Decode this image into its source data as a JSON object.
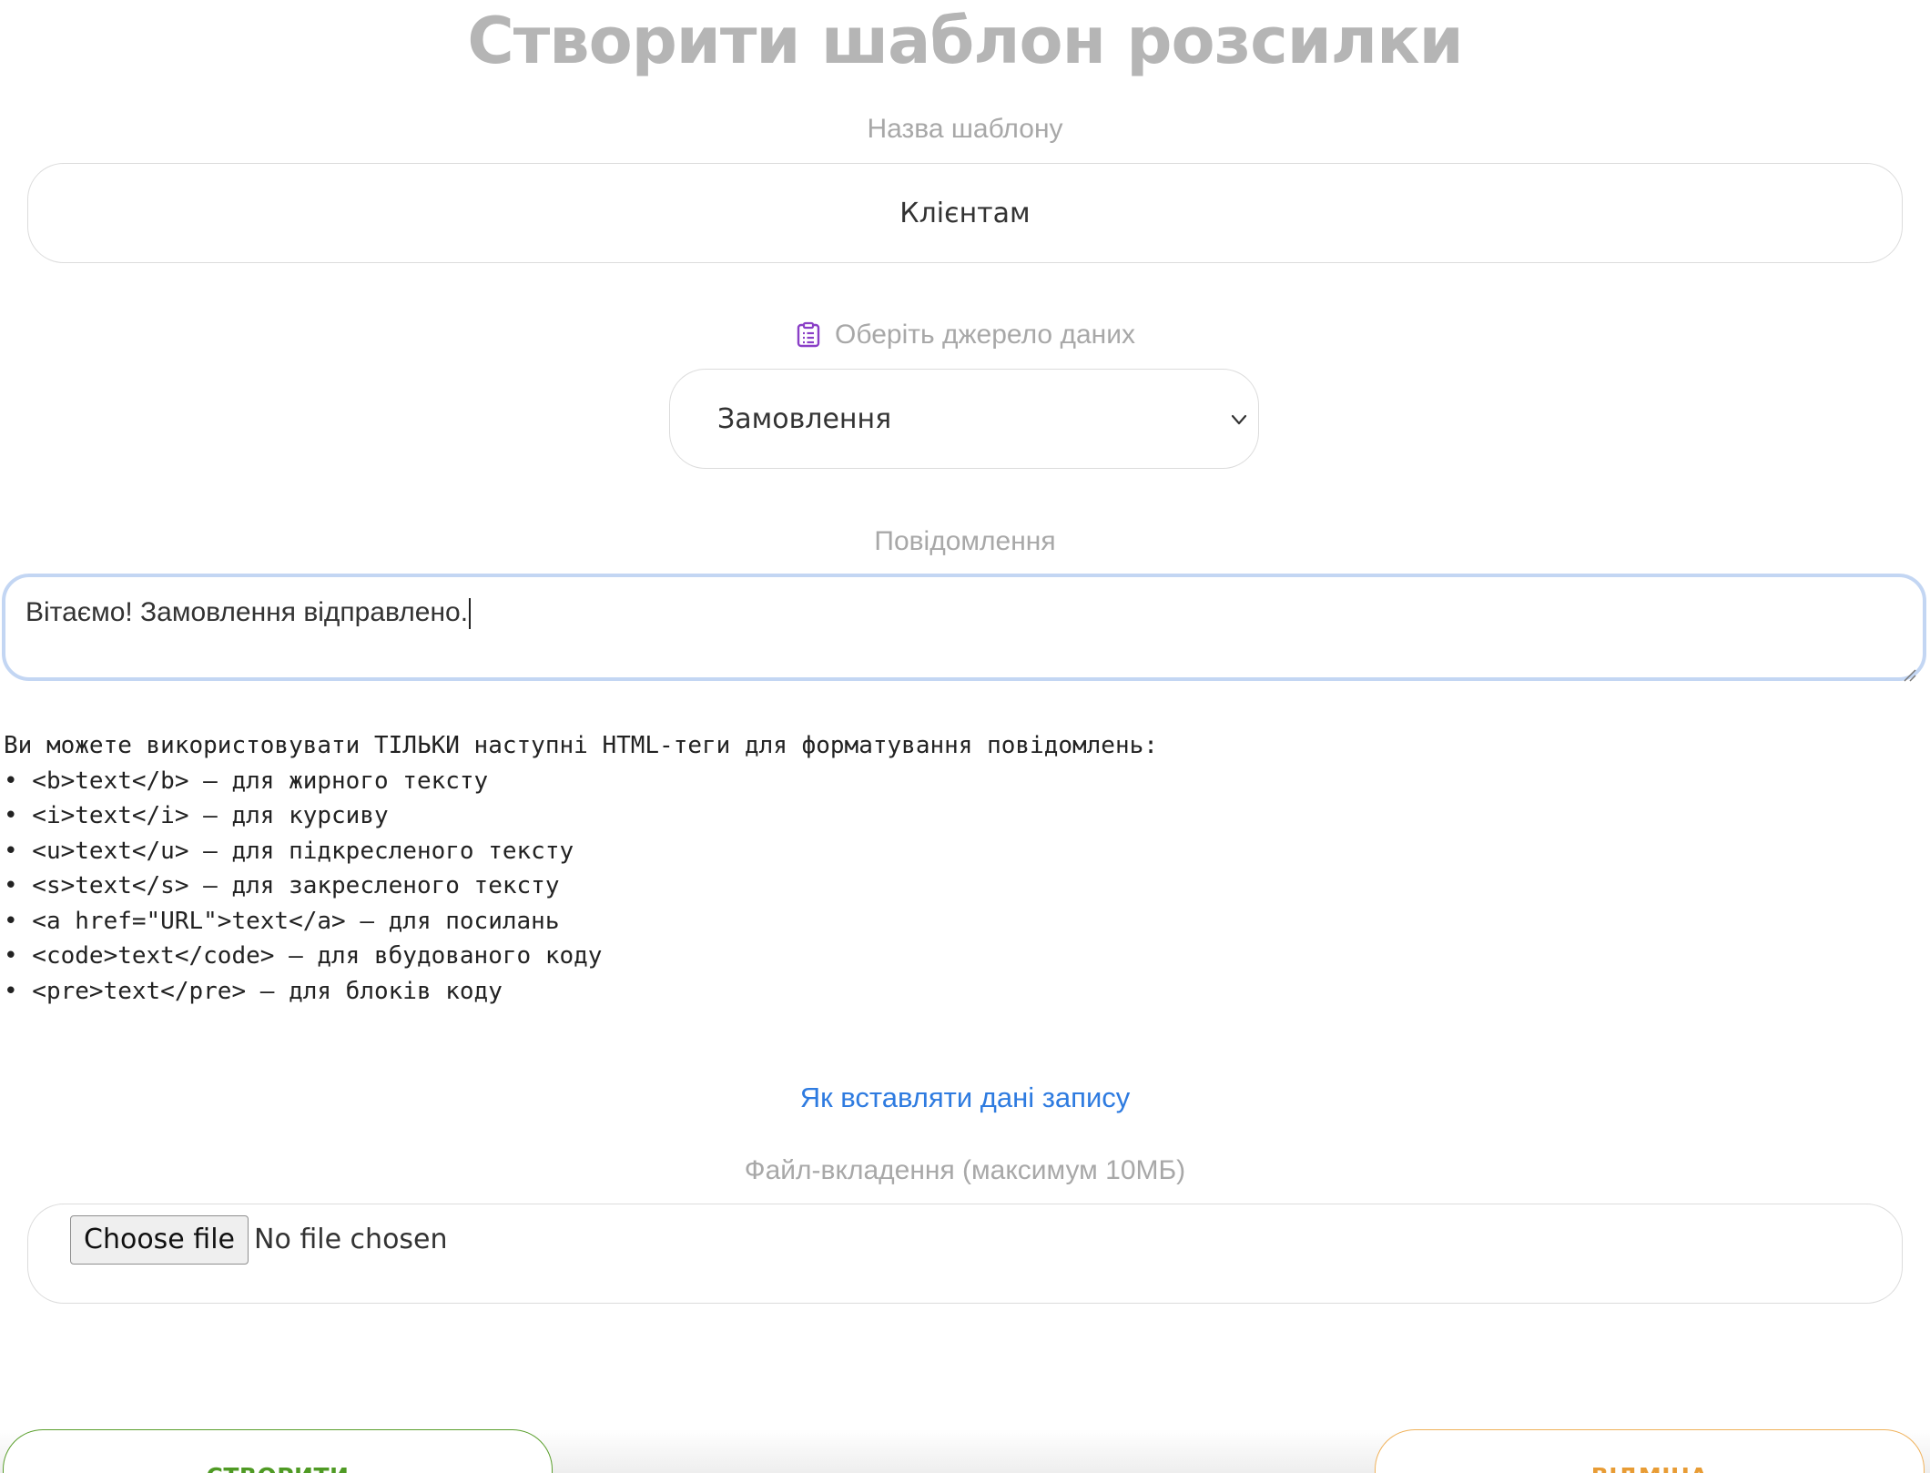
{
  "page": {
    "title": "Створити шаблон розсилки"
  },
  "template_name": {
    "label": "Назва шаблону",
    "value": "Клієнтам"
  },
  "data_source": {
    "icon": "clipboard-list-icon",
    "label": "Оберіть джерело даних",
    "selected": "Замовлення"
  },
  "message": {
    "label": "Повідомлення",
    "value": "Вітаємо! Замовлення відправлено."
  },
  "formatting_help": {
    "intro": "Ви можете використовувати ТІЛЬКИ наступні HTML-теги для форматування повідомлень:",
    "items": [
      "• <b>text</b> – для жирного тексту",
      "• <i>text</i> – для курсиву",
      "• <u>text</u> – для підкресленого тексту",
      "• <s>text</s> – для закресленого тексту",
      "• <a href=\"URL\">text</a> – для посилань",
      "• <code>text</code> – для вбудованого коду",
      "• <pre>text</pre> – для блоків коду"
    ]
  },
  "insert_help_link": "Як вставляти дані запису",
  "attachment": {
    "label": "Файл-вкладення (максимум 10МБ)",
    "button_label": "Choose file",
    "status": "No file chosen"
  },
  "actions": {
    "create_label": "СТВОРИТИ",
    "cancel_label": "ВІДМІНА"
  },
  "colors": {
    "accent_link": "#2e7be0",
    "create": "#4f9a24",
    "cancel": "#e89c35",
    "icon": "#8a3fc7",
    "focus_border": "#c3d6f3"
  }
}
